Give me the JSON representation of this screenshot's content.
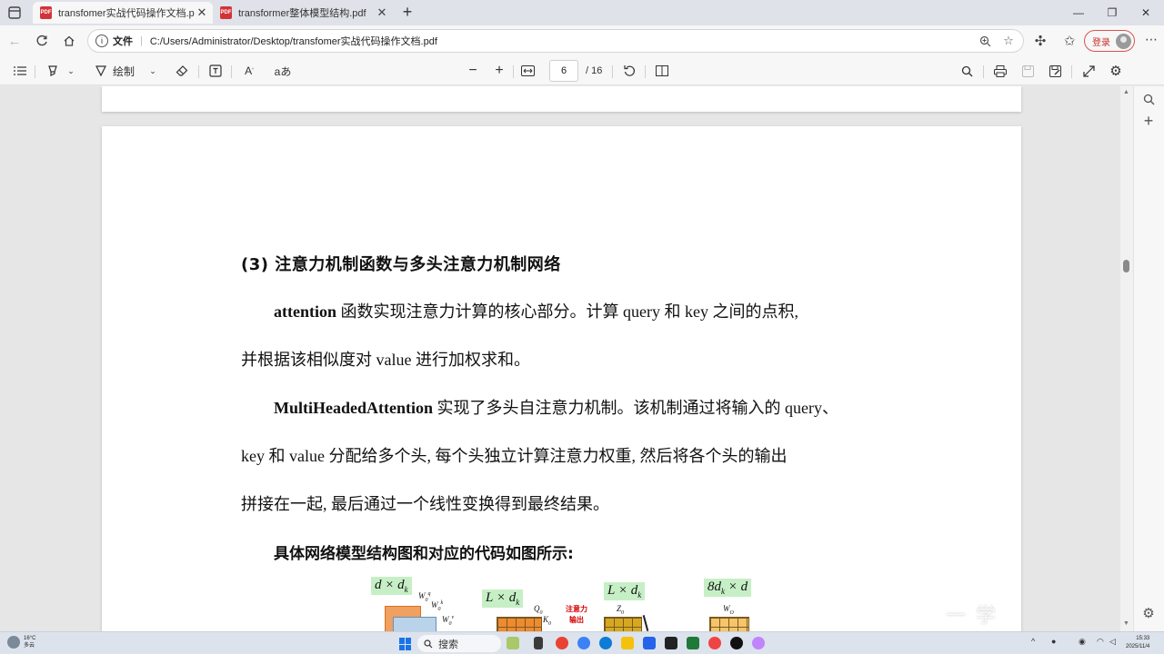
{
  "browser": {
    "tabs": [
      {
        "label": "transfomer实战代码操作文档.pdf",
        "close": "✕",
        "badge": "PDF"
      },
      {
        "label": "transformer整体模型结构.pdf",
        "close": "✕",
        "badge": "PDF"
      }
    ],
    "new_tab": "+",
    "window_controls": {
      "minimize": "—",
      "maximize": "❐",
      "close": "✕"
    },
    "address": {
      "scheme_label": "文件",
      "url": "C:/Users/Administrator/Desktop/transfomer实战代码操作文档.pdf"
    },
    "login_label": "登录"
  },
  "pdf_toolbar": {
    "draw_label": "绘制",
    "page_current": "6",
    "page_total": "/ 16",
    "zoom_out": "−",
    "zoom_in": "+",
    "read_aloud": "aあ"
  },
  "document": {
    "heading": "(3) 注意力机制函数与多头注意力机制网络",
    "p1_line1_bold": "attention",
    "p1_line1_rest": " 函数实现注意力计算的核心部分。计算  query 和 key 之间的点积,",
    "p1_line2": "并根据该相似度对 value 进行加权求和。",
    "p2_line1_bold": "MultiHeadedAttention",
    "p2_line1_rest": " 实现了多头自注意力机制。该机制通过将输入的 query、",
    "p2_line2": "key 和 value 分配给多个头, 每个头独立计算注意力权重, 然后将各个头的输出",
    "p2_line3": "拼接在一起, 最后通过一个线性变换得到最终结果。",
    "subheading": "具体网络模型结构图和对应的代码如图所示:",
    "diagram": {
      "label1": "d × d",
      "label1_sub": "k",
      "label2": "L × d",
      "label2_sub": "k",
      "label3": "L × d",
      "label3_sub": "k",
      "label4": "8d",
      "label4_sub": "k",
      "label4_rest": " × d",
      "w1": "W",
      "w2": "W",
      "w3": "W",
      "q0": "Q",
      "k0": "K",
      "z0": "Z",
      "wo": "W",
      "attn_line1": "注意力",
      "attn_line2": "输出"
    }
  },
  "watermark": "一 学",
  "taskbar": {
    "weather_temp": "16°C",
    "weather_desc": "多云",
    "search_label": "搜索",
    "time": "15:33",
    "date": "2025/11/4"
  },
  "colors": {
    "accent": "#1a73e8",
    "pdf_badge": "#d13438",
    "label_green": "#c6efc6",
    "attn_red": "#d40000",
    "login_red": "#c9302c"
  }
}
